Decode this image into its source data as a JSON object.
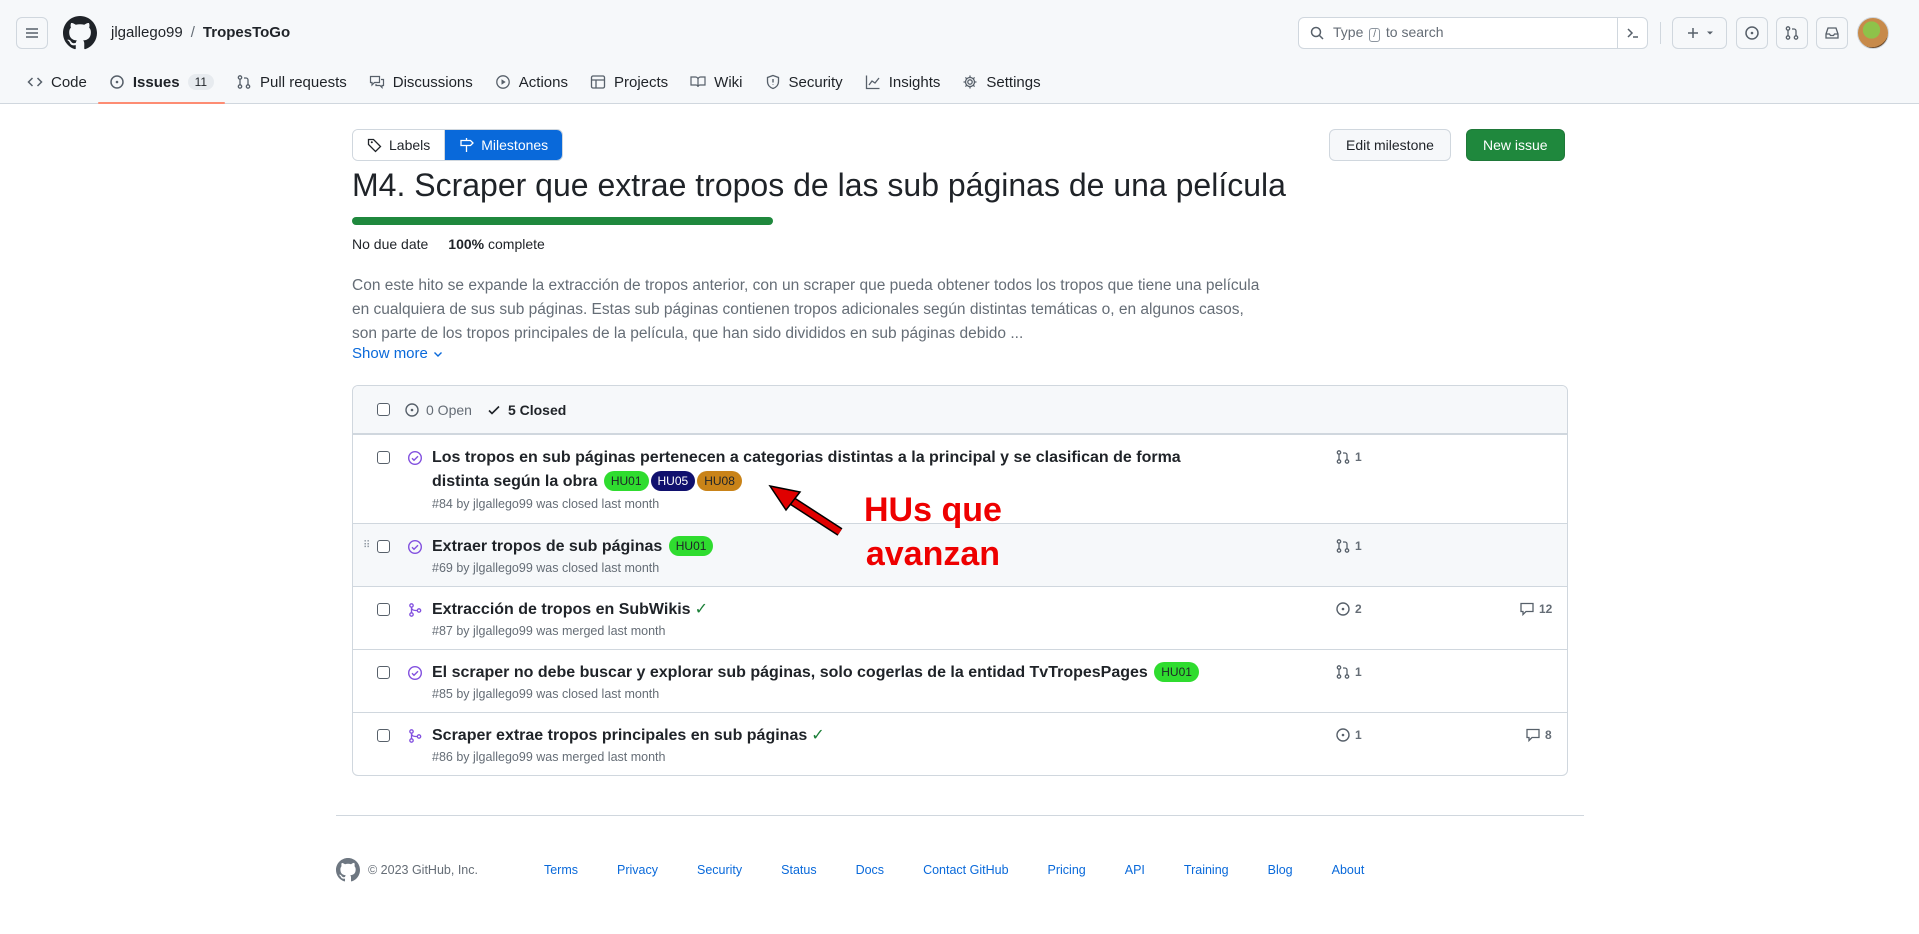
{
  "header": {
    "owner": "jlgallego99",
    "separator": "/",
    "repo": "TropesToGo",
    "search_prefix": "Type",
    "search_key": "/",
    "search_suffix": "to search"
  },
  "tabs": [
    {
      "label": "Code",
      "icon": "code-icon"
    },
    {
      "label": "Issues",
      "icon": "issue-opened-icon",
      "count": "11"
    },
    {
      "label": "Pull requests",
      "icon": "git-pull-request-icon"
    },
    {
      "label": "Discussions",
      "icon": "comment-discussion-icon"
    },
    {
      "label": "Actions",
      "icon": "play-icon"
    },
    {
      "label": "Projects",
      "icon": "table-icon"
    },
    {
      "label": "Wiki",
      "icon": "book-icon"
    },
    {
      "label": "Security",
      "icon": "shield-icon"
    },
    {
      "label": "Insights",
      "icon": "graph-icon"
    },
    {
      "label": "Settings",
      "icon": "gear-icon"
    }
  ],
  "milestone": {
    "labels_btn": "Labels",
    "milestones_btn": "Milestones",
    "edit_btn": "Edit milestone",
    "new_btn": "New issue",
    "title": "M4. Scraper que extrae tropos de las sub páginas de una película",
    "due": "No due date",
    "percent": "100%",
    "complete": "complete",
    "progress_fraction": 1.0,
    "description": "Con este hito se expande la extracción de tropos anterior, con un scraper que pueda obtener todos los tropos que tiene una película en cualquiera de sus sub páginas. Estas sub páginas contienen tropos adicionales según distintas temáticas o, en algunos casos, son parte de los tropos principales de la película, que han sido divididos en sub páginas debido ...",
    "show_more": "Show more"
  },
  "filters": {
    "open": "0 Open",
    "closed": "5 Closed"
  },
  "issues": [
    {
      "title": "Los tropos en sub páginas pertenecen a categorias distintas a la principal y se clasifican de forma distinta según la obra",
      "labels": [
        "HU01",
        "HU05",
        "HU08"
      ],
      "sub": "#84 by jlgallego99 was closed last month",
      "pr_count": "1"
    },
    {
      "title": "Extraer tropos de sub páginas",
      "labels": [
        "HU01"
      ],
      "sub": "#69 by jlgallego99 was closed last month",
      "pr_count": "1"
    },
    {
      "title": "Extracción de tropos en SubWikis",
      "check": "✓",
      "sub": "#87 by jlgallego99 was merged last month",
      "issue_count": "2",
      "comments": "12"
    },
    {
      "title": "El scraper no debe buscar y explorar sub páginas, solo cogerlas de la entidad TvTropesPages",
      "labels": [
        "HU01"
      ],
      "sub": "#85 by jlgallego99 was closed last month",
      "pr_count": "1"
    },
    {
      "title": "Scraper extrae tropos principales en sub páginas",
      "check": "✓",
      "sub": "#86 by jlgallego99 was merged last month",
      "issue_count": "1",
      "comments": "8"
    }
  ],
  "annotation": {
    "line1": "HUs que",
    "line2": "avanzan",
    "color": "#ee0000"
  },
  "footer": {
    "copyright": "© 2023 GitHub, Inc.",
    "links": [
      "Terms",
      "Privacy",
      "Security",
      "Status",
      "Docs",
      "Contact GitHub",
      "Pricing",
      "API",
      "Training",
      "Blog",
      "About"
    ]
  },
  "colors": {
    "accent": "#0969da",
    "success": "#1f883d",
    "done": "#8250df",
    "tab_underline": "#fd8c73"
  }
}
